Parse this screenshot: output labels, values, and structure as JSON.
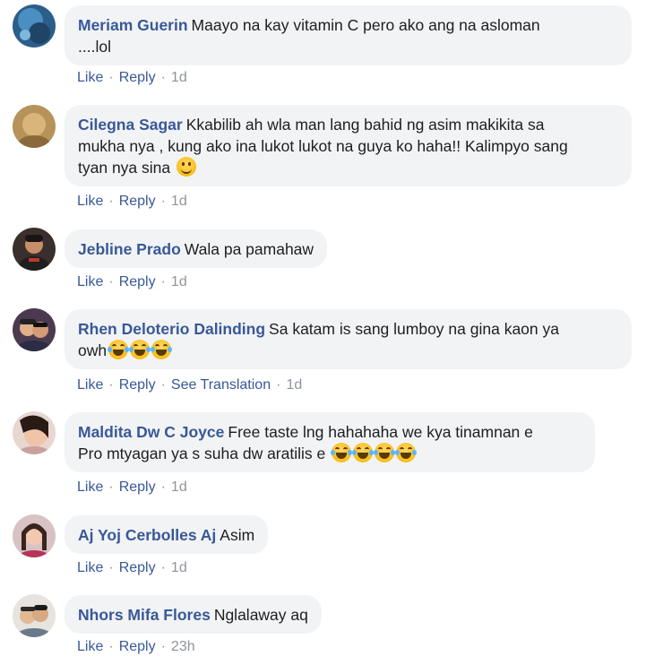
{
  "comments": [
    {
      "author": "Meriam Guerin",
      "text": "Maayo na kay vitamin C pero ako ang na asloman",
      "text2": "....lol",
      "like": "Like",
      "reply": "Reply",
      "time": "1d",
      "avatar_icon": "avatar-underwater-photo"
    },
    {
      "author": "Cilegna Sagar",
      "text": "Kkabilib ah wla man lang bahid ng asim makikita sa",
      "text2": "mukha nya , kung ako ina lukot lukot na guya ko haha!! Kalimpyo sang",
      "text3": "tyan nya sina",
      "like": "Like",
      "reply": "Reply",
      "time": "1d",
      "avatar_icon": "avatar-sepia-photo"
    },
    {
      "author": "Jebline Prado",
      "text": "Wala pa pamahaw",
      "like": "Like",
      "reply": "Reply",
      "time": "1d",
      "avatar_icon": "avatar-person-photo"
    },
    {
      "author": "Rhen Deloterio Dalinding",
      "text": "Sa katam is sang lumboy na gina kaon ya",
      "text2": "owh",
      "like": "Like",
      "reply": "Reply",
      "translate": "See Translation",
      "time": "1d",
      "avatar_icon": "avatar-couple-photo"
    },
    {
      "author": "Maldita Dw C Joyce",
      "text": "Free taste lng hahahaha we kya tinamnan e",
      "text2": "Pro mtyagan ya s suha dw aratilis e",
      "like": "Like",
      "reply": "Reply",
      "time": "1d",
      "avatar_icon": "avatar-selfie-photo"
    },
    {
      "author": "Aj Yoj Cerbolles Aj",
      "text": "Asim",
      "like": "Like",
      "reply": "Reply",
      "time": "1d",
      "avatar_icon": "avatar-woman-photo"
    },
    {
      "author": "Nhors Mifa Flores",
      "text": "Nglalaway aq",
      "like": "Like",
      "reply": "Reply",
      "time": "23h",
      "avatar_icon": "avatar-couple-photo"
    }
  ],
  "colors": {
    "link": "#385898",
    "bubble_bg": "#f2f3f5",
    "meta_gray": "#90949c"
  }
}
